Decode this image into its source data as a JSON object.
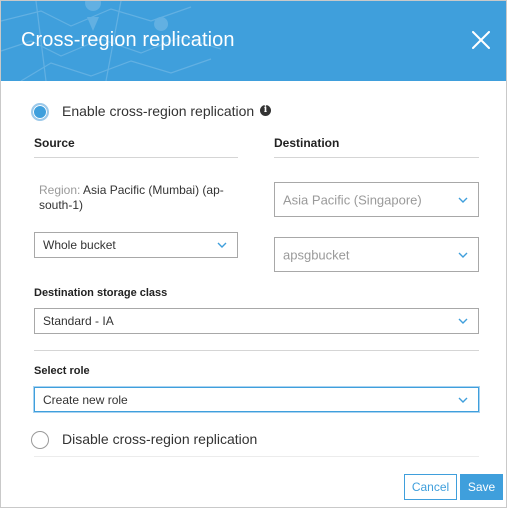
{
  "dialog": {
    "title": "Cross-region replication"
  },
  "enable_option": {
    "label": "Enable cross-region replication",
    "selected": true
  },
  "source": {
    "header": "Source",
    "region_label": "Region:",
    "region_value_line1": "Asia Pacific (Mumbai) (ap-",
    "region_value_line2": "south-1)",
    "bucket_scope": "Whole bucket"
  },
  "destination": {
    "header": "Destination",
    "region": "Asia Pacific (Singapore)",
    "bucket": "apsgbucket"
  },
  "storage_class": {
    "label": "Destination storage class",
    "value": "Standard - IA"
  },
  "role": {
    "label": "Select role",
    "value": "Create new role"
  },
  "disable_option": {
    "label": "Disable cross-region replication",
    "selected": false
  },
  "footer": {
    "cancel_label": "Cancel",
    "save_label": "Save"
  },
  "colors": {
    "accent": "#3f9fdc",
    "header_bg": "#3f9fdc"
  },
  "icons": [
    "close-icon",
    "info-icon",
    "chevron-down-icon",
    "map-pin-icon"
  ]
}
